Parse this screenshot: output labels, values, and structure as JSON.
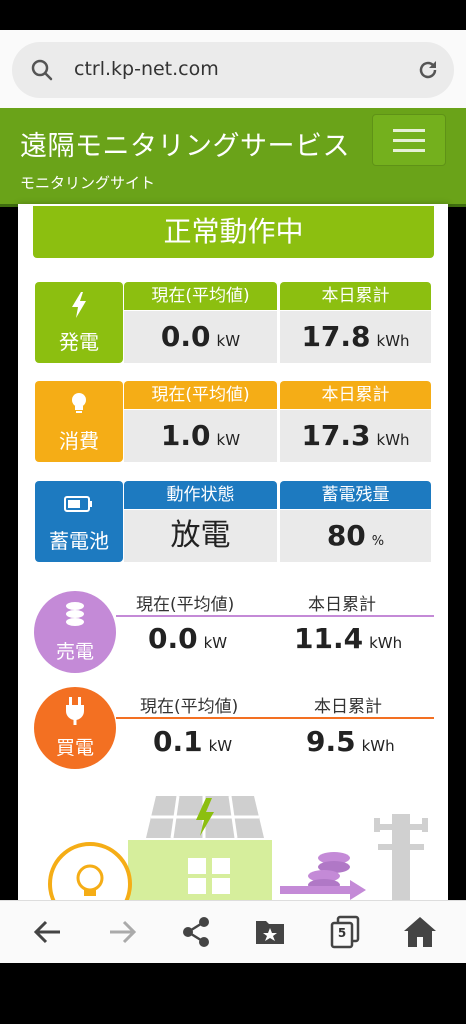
{
  "browser": {
    "url": "ctrl.kp-net.com"
  },
  "header": {
    "title": "遠隔モニタリングサービス",
    "subtitle": "モニタリングサイト"
  },
  "status": {
    "banner": "正常動作中"
  },
  "colors": {
    "green": "#8cbf10",
    "orange": "#f5ad16",
    "blue": "#1d7ac0",
    "purple": "#c48ad7",
    "red_orange": "#f37022"
  },
  "generation": {
    "label": "発電",
    "icon": "lightning-icon",
    "col1_header": "現在(平均値)",
    "col2_header": "本日累計",
    "current_value": "0.0",
    "current_unit": "kW",
    "total_value": "17.8",
    "total_unit": "kWh"
  },
  "consumption": {
    "label": "消費",
    "icon": "lightbulb-icon",
    "col1_header": "現在(平均値)",
    "col2_header": "本日累計",
    "current_value": "1.0",
    "current_unit": "kW",
    "total_value": "17.3",
    "total_unit": "kWh"
  },
  "battery": {
    "label": "蓄電池",
    "icon": "battery-icon",
    "col1_header": "動作状態",
    "col2_header": "蓄電残量",
    "state": "放電",
    "remaining_value": "80",
    "remaining_unit": "%"
  },
  "selling": {
    "label": "売電",
    "icon": "coins-icon",
    "col1_header": "現在(平均値)",
    "col2_header": "本日累計",
    "current_value": "0.0",
    "current_unit": "kW",
    "total_value": "11.4",
    "total_unit": "kWh"
  },
  "buying": {
    "label": "買電",
    "icon": "plug-icon",
    "col1_header": "現在(平均値)",
    "col2_header": "本日累計",
    "current_value": "0.1",
    "current_unit": "kW",
    "total_value": "9.5",
    "total_unit": "kWh"
  },
  "nav": {
    "tab_count": "5"
  }
}
